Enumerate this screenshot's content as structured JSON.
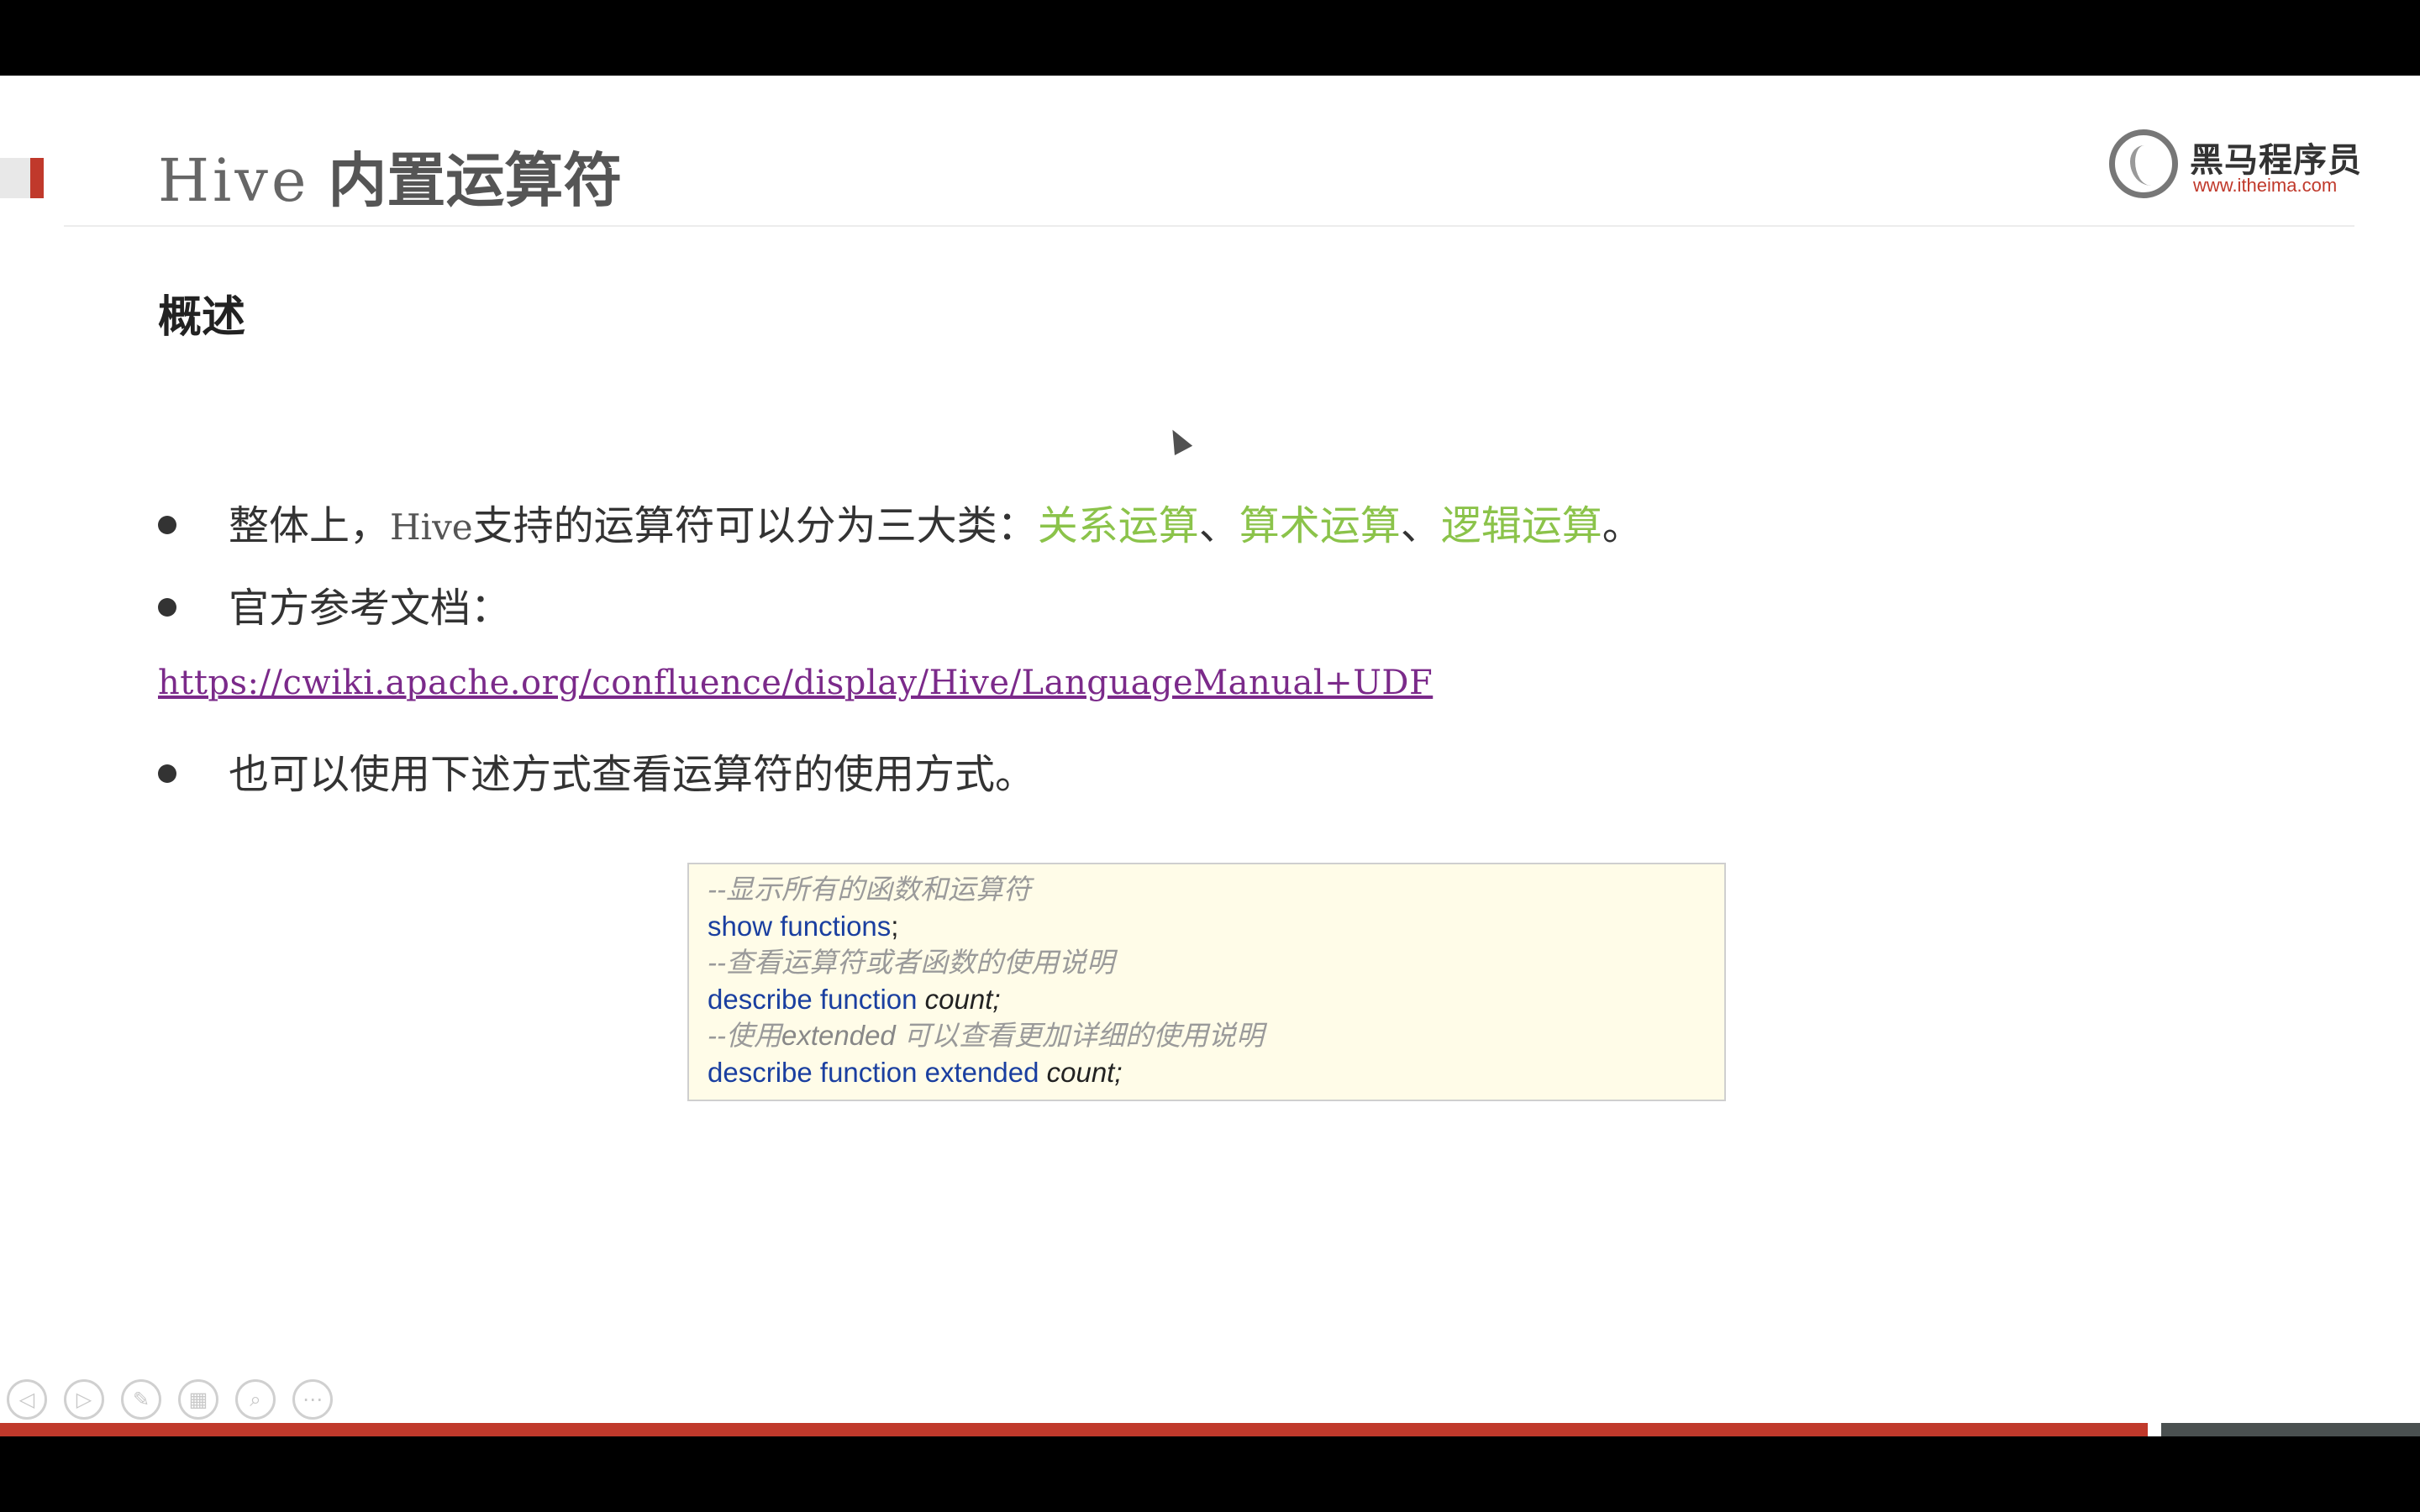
{
  "slide": {
    "title_latin": "Hive",
    "title_cjk": "内置运算符",
    "logo_text": "黑马程序员",
    "logo_url": "www.itheima.com",
    "section_heading": "概述",
    "bullet1": {
      "prefix": "整体上，",
      "hive": "Hive",
      "middle": "支持的运算符可以分为三大类：",
      "cat1": "关系运算",
      "sep1": "、",
      "cat2": "算术运算",
      "sep2": "、",
      "cat3": "逻辑运算",
      "end": "。"
    },
    "bullet2": "官方参考文档：",
    "doc_link": "https://cwiki.apache.org/confluence/display/Hive/LanguageManual+UDF",
    "bullet3": "也可以使用下述方式查看运算符的使用方式。",
    "code": {
      "line1_comment": "--显示所有的函数和运算符",
      "line2_kw": "show functions",
      "line2_end": ";",
      "line3_comment": "--查看运算符或者函数的使用说明",
      "line4_kw": "describe function ",
      "line4_arg": "count",
      "line4_end": ";",
      "line5_pre": "--使用",
      "line5_kw": "extended",
      "line5_post": " 可以查看更加详细的使用说明",
      "line6_kw": "describe function extended ",
      "line6_arg": "count",
      "line6_end": ";"
    }
  },
  "controls": {
    "icons": [
      "prev-icon",
      "next-icon",
      "pen-icon",
      "slides-icon",
      "zoom-icon",
      "more-icon"
    ],
    "prev": "◁",
    "next": "▷",
    "pen": "✎",
    "slides": "▦",
    "zoom": "⌕",
    "more": "⋯"
  },
  "colors": {
    "accent_red": "#c0392b",
    "category_green": "#8bc34a",
    "link_purple": "#7b2a8a",
    "code_keyword_blue": "#1a3fa0",
    "code_bg": "#fffce8"
  }
}
